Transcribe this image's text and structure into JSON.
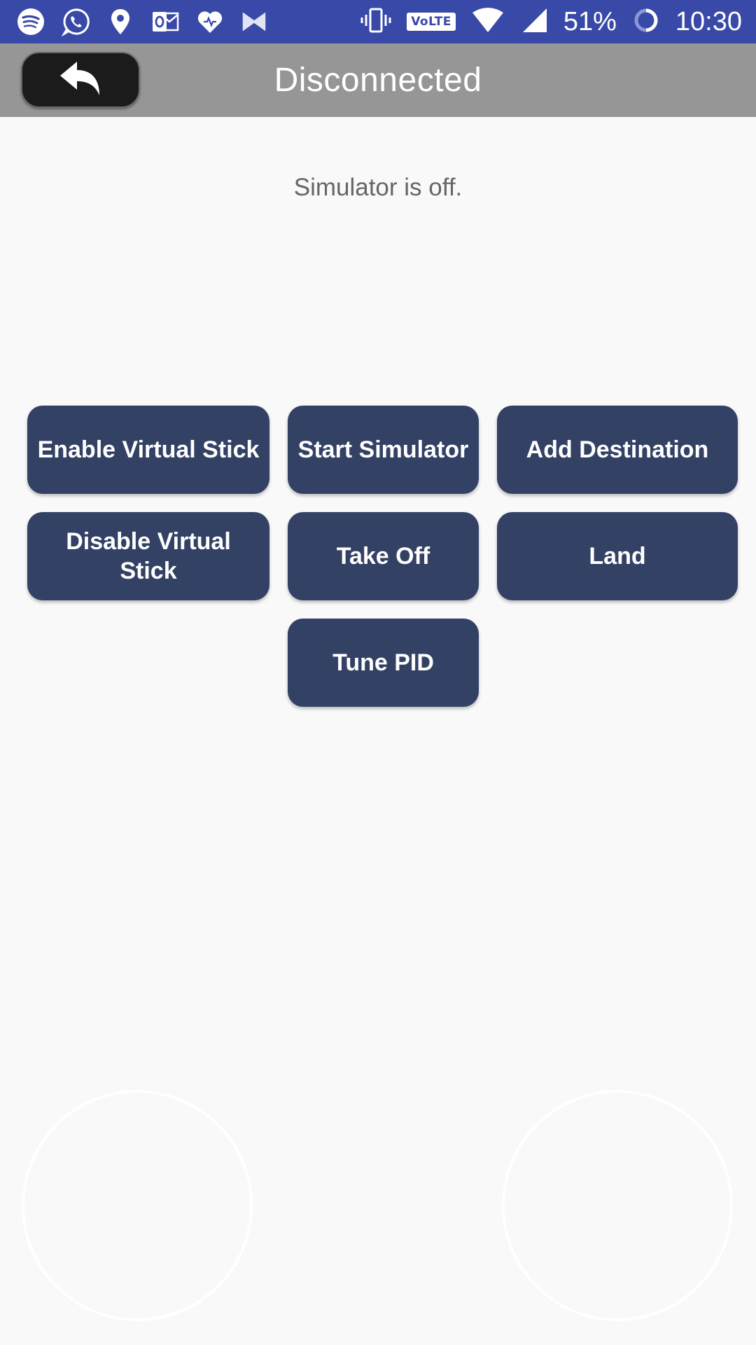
{
  "status_bar": {
    "icons_left": [
      "spotify-icon",
      "whatsapp-icon",
      "location-pin-icon",
      "outlook-icon",
      "heart-icon",
      "bowtie-app-icon"
    ],
    "icons_right": [
      "vibrate-icon",
      "volte-badge",
      "wifi-icon",
      "signal-icon",
      "battery-ring-icon"
    ],
    "volte_label": "VoLTE",
    "battery": "51%",
    "time": "10:30"
  },
  "header": {
    "title": "Disconnected",
    "back_icon": "back-arrow-icon"
  },
  "main": {
    "status_message": "Simulator is off.",
    "buttons": {
      "enable_virtual_stick": "Enable Virtual Stick",
      "start_simulator": "Start Simulator",
      "add_destination": "Add Destination",
      "disable_virtual_stick": "Disable Virtual Stick",
      "take_off": "Take Off",
      "land": "Land",
      "tune_pid": "Tune PID"
    }
  },
  "colors": {
    "status_bar": "#3949a8",
    "header": "#969696",
    "button": "#334165",
    "background": "#f9f9fa"
  }
}
